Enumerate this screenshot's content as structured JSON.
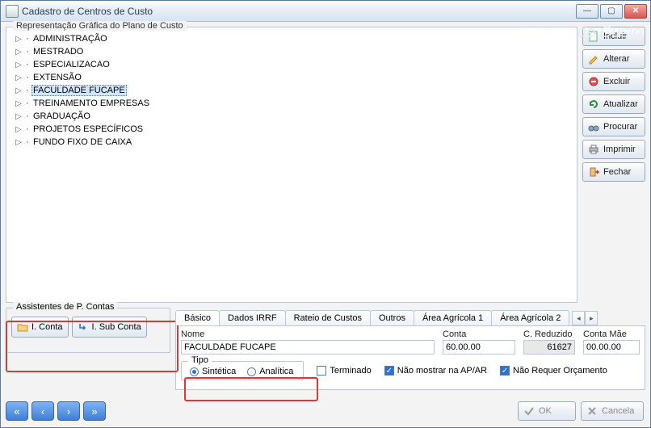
{
  "window": {
    "title": "Cadastro de Centros  de Custo"
  },
  "watermark": "Centro de Custo",
  "tree_legend": "Representação Gráfica do Plano de Custo",
  "tree": {
    "items": [
      {
        "label": "ADMINISTRAÇÃO"
      },
      {
        "label": "MESTRADO"
      },
      {
        "label": "ESPECIALIZACAO"
      },
      {
        "label": "EXTENSÃO"
      },
      {
        "label": "FACULDADE FUCAPE",
        "selected": true
      },
      {
        "label": "TREINAMENTO EMPRESAS"
      },
      {
        "label": "GRADUAÇÃO"
      },
      {
        "label": "PROJETOS ESPECÍFICOS"
      },
      {
        "label": "FUNDO FIXO DE CAIXA"
      }
    ]
  },
  "sidebar": {
    "incluir": "Incluir",
    "alterar": "Alterar",
    "excluir": "Excluir",
    "atualizar": "Atualizar",
    "procurar": "Procurar",
    "imprimir": "Imprimir",
    "fechar": "Fechar"
  },
  "assist": {
    "legend": "Assistentes de P. Contas",
    "iconta": "I. Conta",
    "isubconta": "I. Sub Conta"
  },
  "tabs": {
    "basico": "Básico",
    "dados_irrf": "Dados IRRF",
    "rateio": "Rateio de Custos",
    "outros": "Outros",
    "agri1": "Área Agrícola 1",
    "agri2": "Área Agrícola 2"
  },
  "form": {
    "nome_label": "Nome",
    "nome_value": "FACULDADE FUCAPE",
    "conta_label": "Conta",
    "conta_value": "60.00.00",
    "creduzido_label": "C. Reduzido",
    "creduzido_value": "61627",
    "cmae_label": "Conta Mãe",
    "cmae_value": "00.00.00",
    "tipo_legend": "Tipo",
    "tipo_sintetica": "Sintética",
    "tipo_analitica": "Analítica",
    "terminado": "Terminado",
    "nao_mostrar": "Não mostrar na AP/AR",
    "nao_orcamento": "Não Requer Orçamento"
  },
  "footer": {
    "ok": "OK",
    "cancela": "Cancela"
  }
}
